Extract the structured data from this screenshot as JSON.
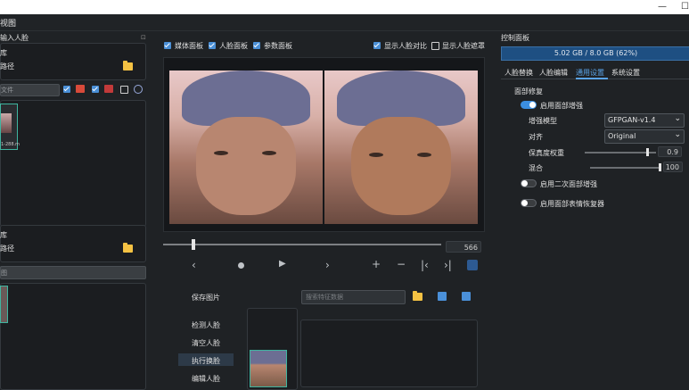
{
  "menubar": {
    "title": "视图"
  },
  "left": {
    "section_top_title": "输入人脸",
    "lib1": {
      "title": "库",
      "path_label": "路径",
      "file_placeholder": "文件",
      "thumb_label": "1-288.m"
    },
    "lib2": {
      "title": "库",
      "path_label": "路径",
      "search_placeholder": "图"
    }
  },
  "center": {
    "checkboxes": [
      {
        "label": "媒体面板",
        "checked": true
      },
      {
        "label": "人脸面板",
        "checked": true
      },
      {
        "label": "参数面板",
        "checked": true
      }
    ],
    "right_checkboxes": [
      {
        "label": "显示人脸对比",
        "checked": true
      },
      {
        "label": "显示人脸遮罩",
        "checked": false
      }
    ],
    "frame_number": "566",
    "buttons": {
      "save_image": "保存图片",
      "detect_faces": "检测人脸",
      "clear_faces": "清空人脸",
      "swap_faces": "执行换脸",
      "edit_faces": "编辑人脸"
    },
    "search_placeholder": "搜索特征数据"
  },
  "right": {
    "panel_title": "控制面板",
    "vram_text": "5.02 GB / 8.0 GB (62%)",
    "vram_fraction": 0.62,
    "tabs": [
      "人脸替换",
      "人脸编辑",
      "通用设置",
      "系统设置"
    ],
    "active_tab": 2,
    "group_title": "面部修复",
    "enable_restore": "启用面部增强",
    "model_label": "增强模型",
    "model_value": "GFPGAN-v1.4",
    "align_label": "对齐",
    "align_value": "Original",
    "fidelity_label": "保真度权重",
    "fidelity_value": "0.9",
    "blend_label": "混合",
    "blend_value": "100",
    "enable_second": "启用二次面部增强",
    "enable_expression": "启用面部表情恢复器"
  }
}
